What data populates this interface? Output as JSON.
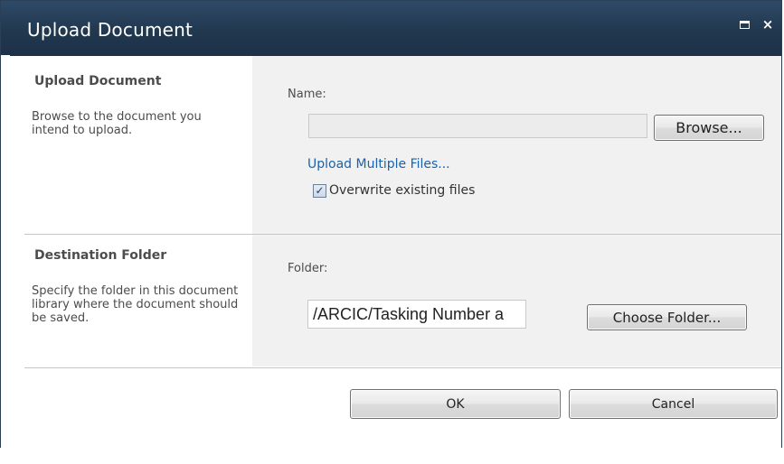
{
  "dialog": {
    "title": "Upload Document",
    "controls": {
      "maximize": "maximize-icon",
      "close": "×"
    }
  },
  "upload_section": {
    "heading": "Upload Document",
    "description": "Browse to the document you intend to upload.",
    "name_label": "Name:",
    "file_value": "",
    "browse_label": "Browse...",
    "multiple_files_link": "Upload Multiple Files...",
    "overwrite_checked": true,
    "check_glyph": "✓",
    "overwrite_label": "Overwrite existing files"
  },
  "folder_section": {
    "heading": "Destination Folder",
    "description": "Specify the folder in this document library where the document should be saved.",
    "folder_label": "Folder:",
    "folder_value": "/ARCIC/Tasking Number a",
    "choose_label": "Choose Folder..."
  },
  "footer": {
    "ok_label": "OK",
    "cancel_label": "Cancel"
  },
  "colors": {
    "titlebar": "#21384f",
    "field_background": "#f1f1f1",
    "link": "#1a62ac"
  }
}
